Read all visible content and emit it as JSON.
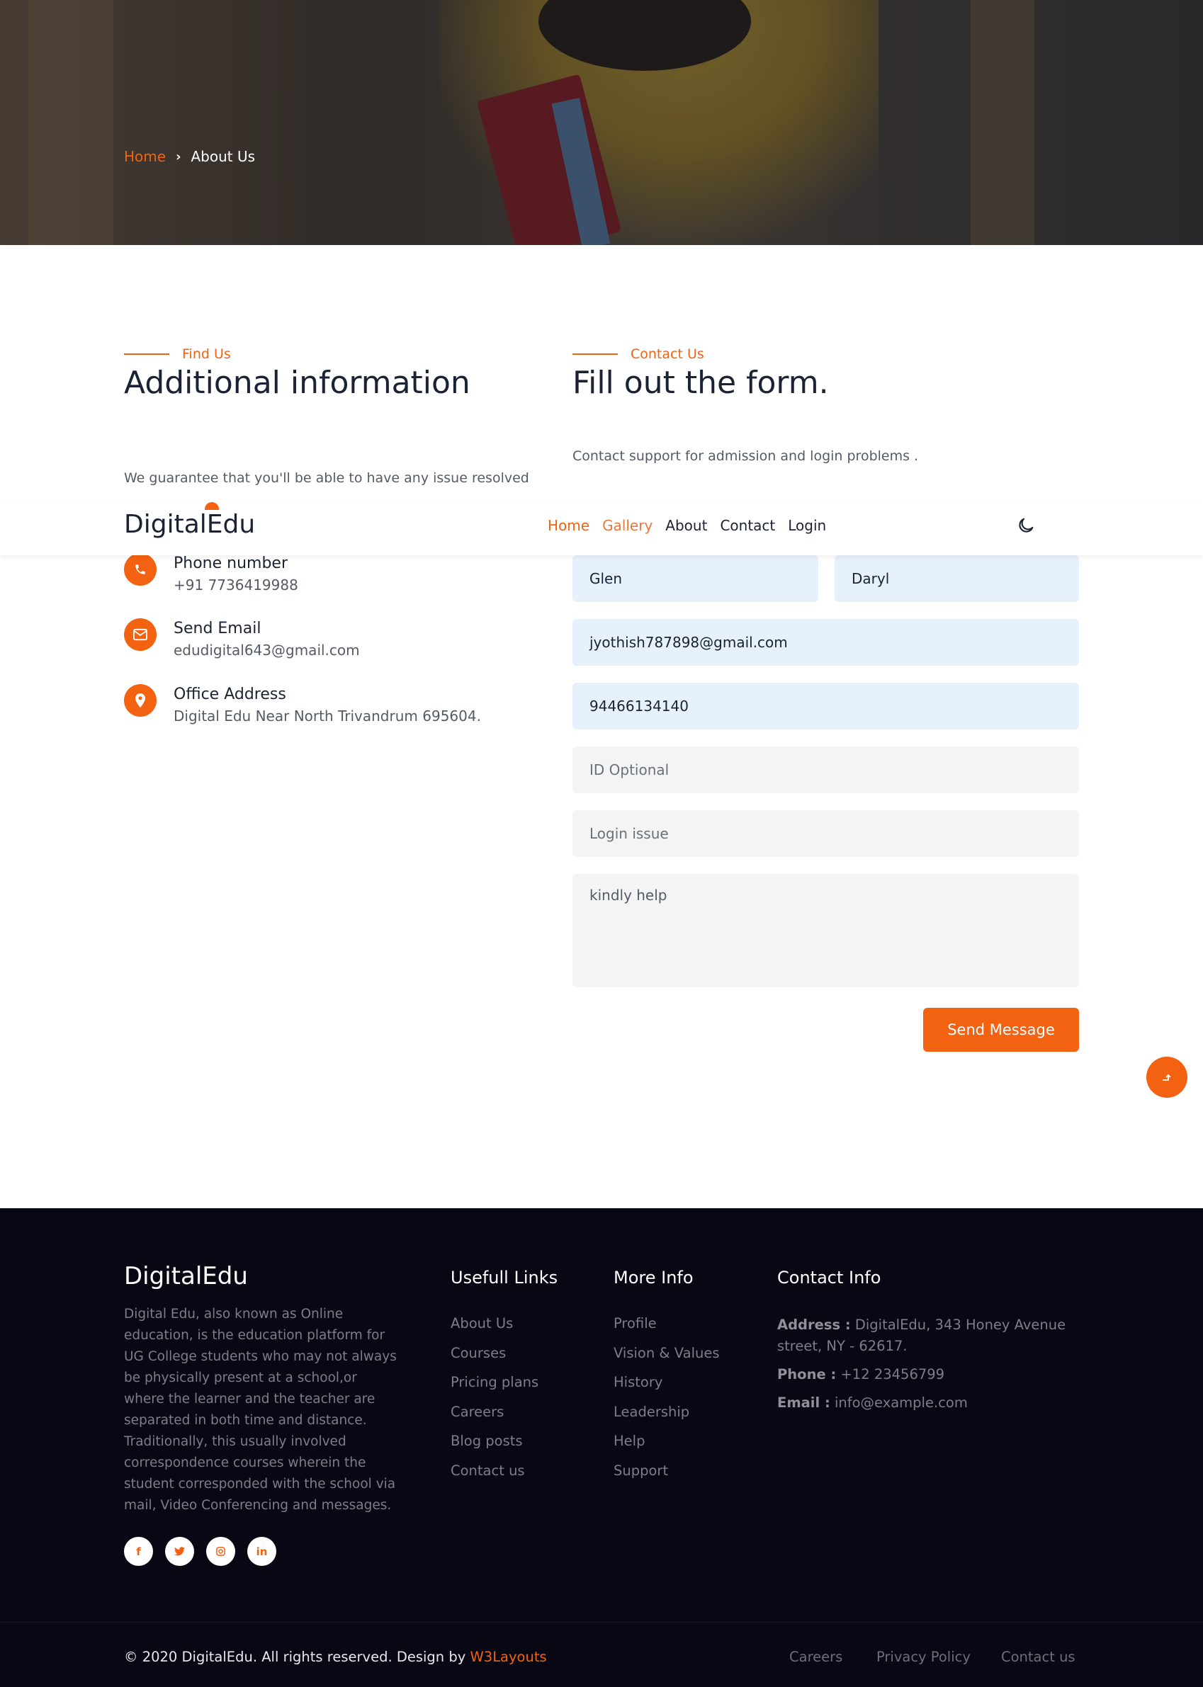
{
  "breadcrumb": {
    "home": "Home",
    "separator": "›",
    "current": "About Us"
  },
  "find_us": {
    "eyebrow": "Find Us",
    "title": "Additional information",
    "text": "We guarantee that you'll be able to have any issue resolved"
  },
  "contact_us": {
    "eyebrow": "Contact Us",
    "title": "Fill out the form.",
    "text": "Contact support for admission and login problems ."
  },
  "nav": {
    "logo": "DigitalEdu",
    "links": [
      "Home",
      "Gallery",
      "About",
      "Contact",
      "Login"
    ],
    "theme_toggle_icon": "moon-icon"
  },
  "contact_items": [
    {
      "title": "Phone number",
      "value": "+91 7736419988",
      "icon": "phone-icon"
    },
    {
      "title": "Send Email",
      "value": "edudigital643@gmail.com",
      "icon": "envelope-icon"
    },
    {
      "title": "Office Address",
      "value": "Digital Edu Near North Trivandrum 695604.",
      "icon": "map-pin-icon"
    }
  ],
  "form": {
    "first_name": "Glen",
    "last_name": "Daryl",
    "email": "jyothish787898@gmail.com",
    "phone": "94466134140",
    "id_placeholder": "ID Optional",
    "subject_placeholder": "Login issue",
    "message": "kindly help",
    "submit_label": "Send Message"
  },
  "footer": {
    "logo": "DigitalEdu",
    "about": "Digital Edu, also known as Online education, is the education platform for UG College students who may not always be physically present at a school,or where the learner and the teacher are separated in both time and distance. Traditionally, this usually involved correspondence courses wherein the student corresponded with the school via mail, Video Conferencing and messages.",
    "useful_links": {
      "title": "Usefull Links",
      "items": [
        "About Us",
        "Courses",
        "Pricing plans",
        "Careers",
        "Blog posts",
        "Contact us"
      ]
    },
    "more_info": {
      "title": "More Info",
      "items": [
        "Profile",
        "Vision & Values",
        "History",
        "Leadership",
        "Help",
        "Support"
      ]
    },
    "contact_info": {
      "title": "Contact Info",
      "address_label": "Address :",
      "address": "DigitalEdu, 343 Honey Avenue street, NY - 62617.",
      "phone_label": "Phone :",
      "phone": "+12 23456799",
      "email_label": "Email :",
      "email": "info@example.com"
    },
    "socials": [
      "f",
      "t",
      "ig",
      "in"
    ],
    "copyright": "© 2020 DigitalEdu. All rights reserved. Design by",
    "credit": "W3Layouts",
    "bottom_links": [
      "Careers",
      "Privacy Policy",
      "Contact us"
    ]
  },
  "colors": {
    "accent": "#f36211",
    "footer_bg": "#070814",
    "input_filled": "#e7f0fd",
    "input_empty": "#f4f4f4"
  }
}
